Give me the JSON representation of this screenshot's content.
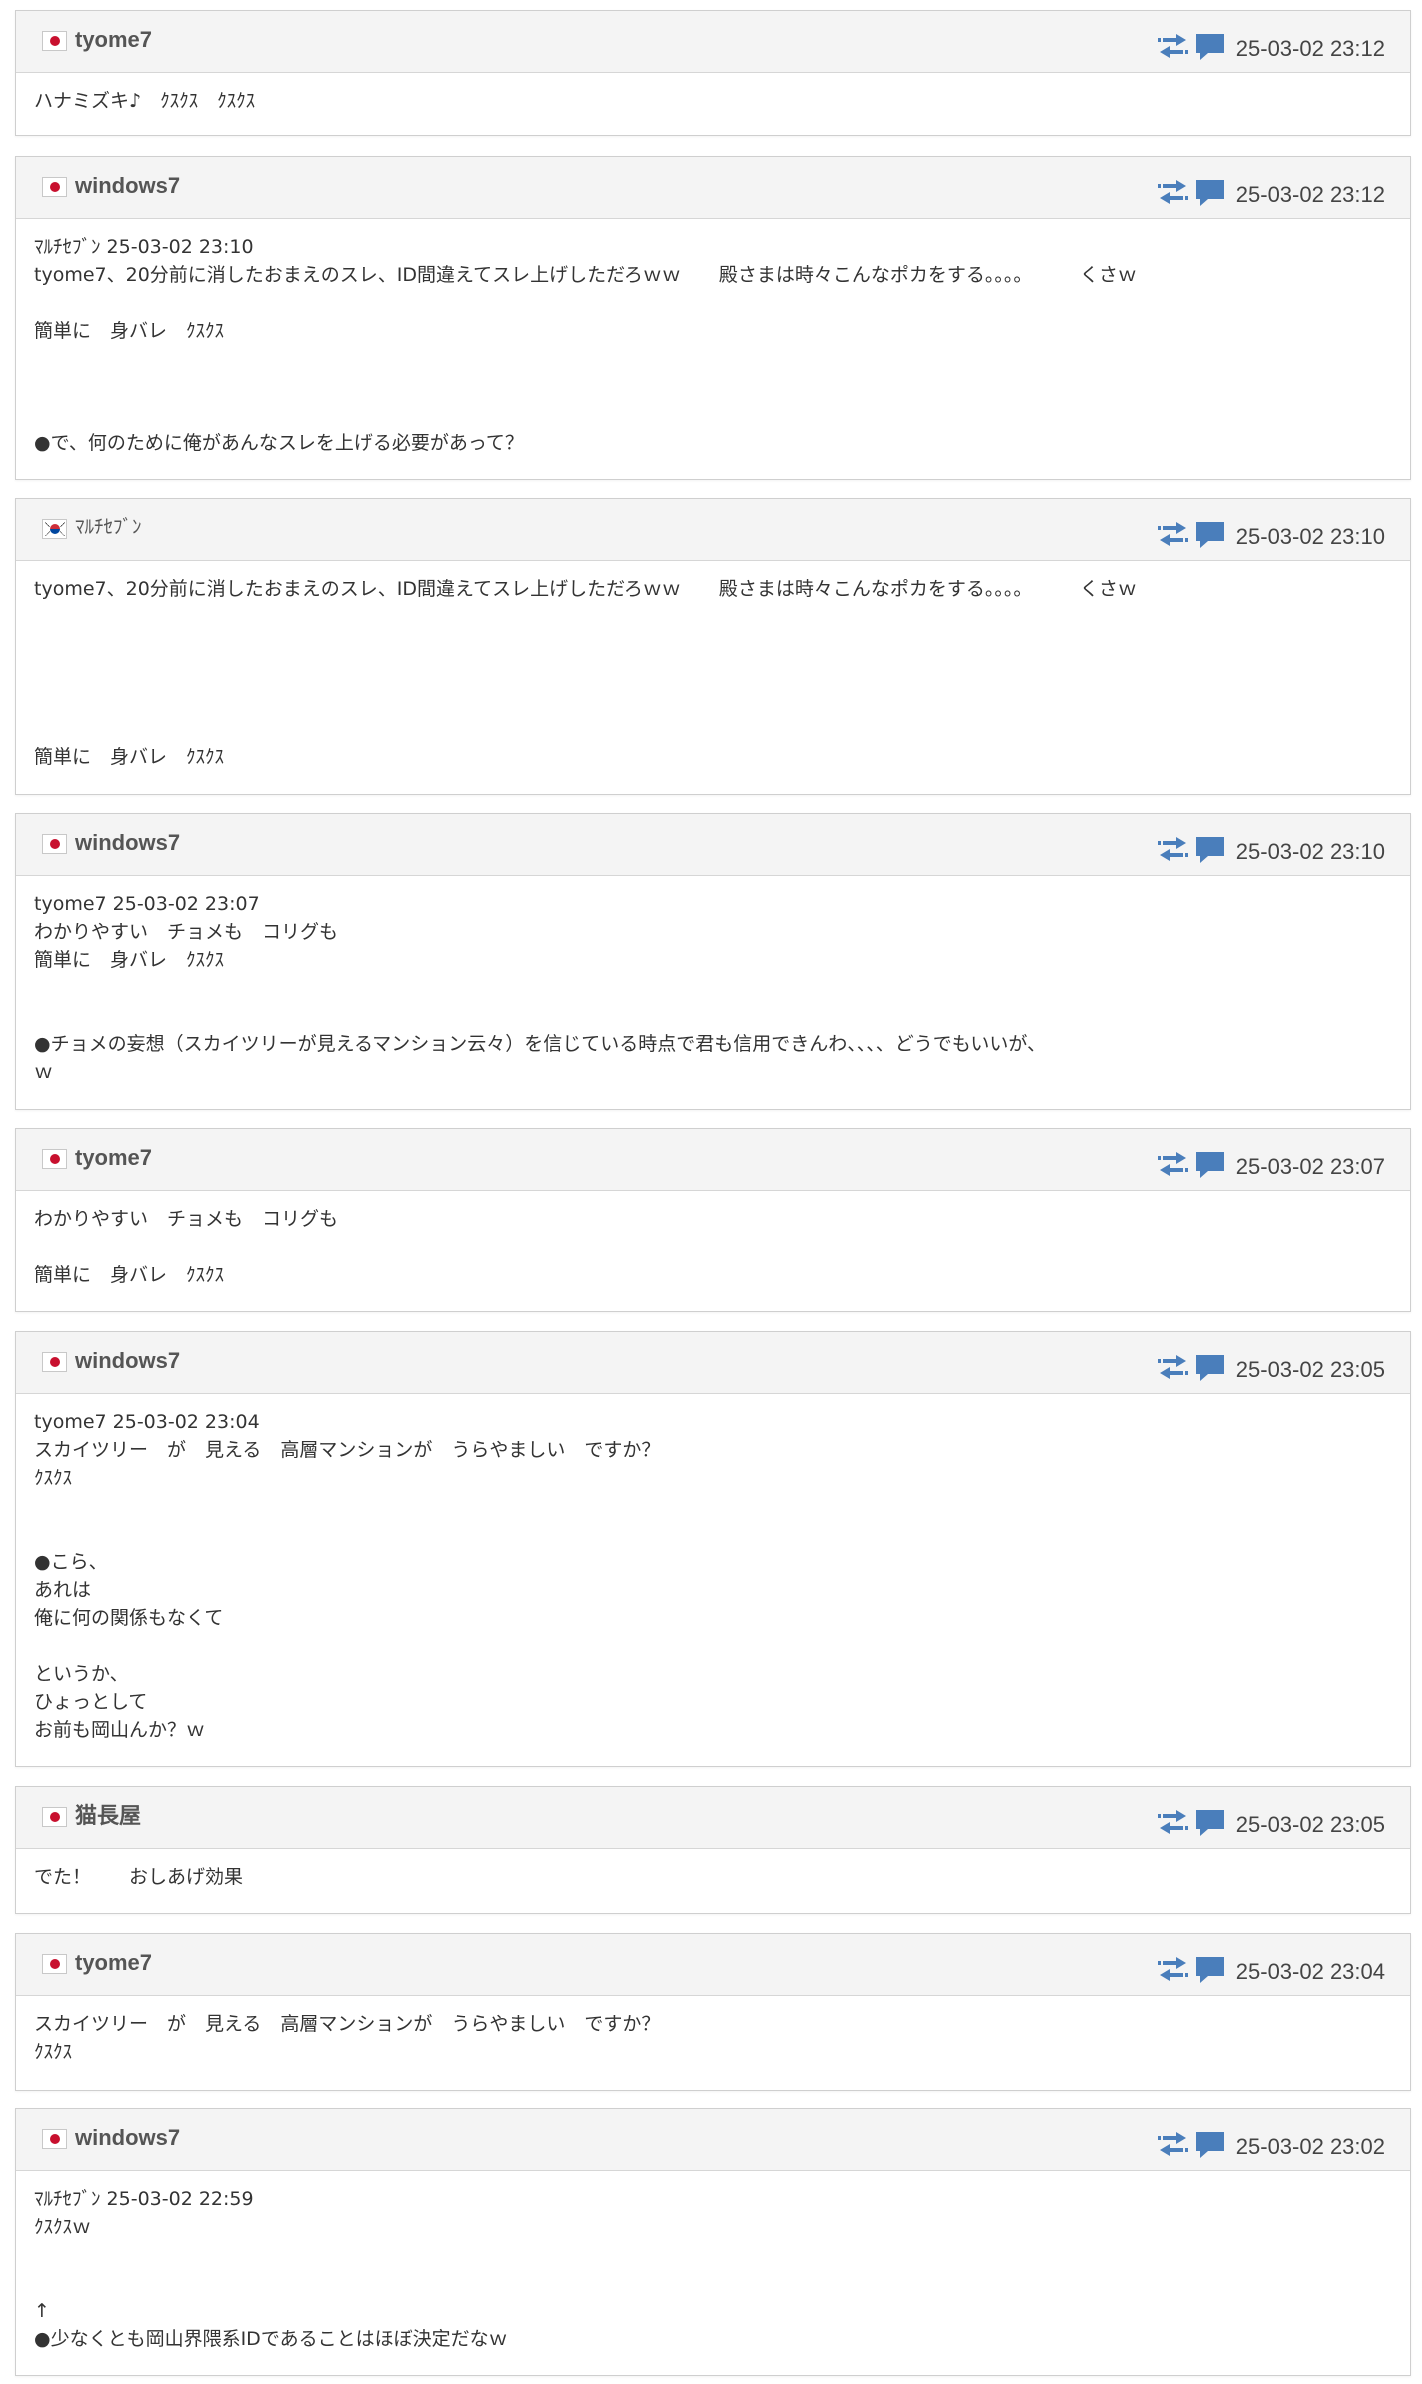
{
  "posts": [
    {
      "flag": "jp",
      "user": "tyome7",
      "time": "25-03-02 23:12",
      "lines": [
        "ハナミズキ♪　ｸｽｸｽ　ｸｽｸｽ"
      ]
    },
    {
      "flag": "jp",
      "user": "windows7",
      "time": "25-03-02 23:12",
      "lines": [
        "ﾏﾙﾁｾﾌﾞﾝ 25-03-02 23:10",
        "tyome7、20分前に消したおまえのスレ、ID間違えてスレ上げしただろｗｗ　　殿さまは時々こんなポカをする。。。。　　　くさｗ",
        "",
        "簡単に　身バレ　ｸｽｸｽ",
        "",
        "",
        "",
        "●で、何のために俺があんなスレを上げる必要があって？"
      ]
    },
    {
      "flag": "kr",
      "user": "ﾏﾙﾁｾﾌﾞﾝ",
      "time": "25-03-02 23:10",
      "lines": [
        "tyome7、20分前に消したおまえのスレ、ID間違えてスレ上げしただろｗｗ　　殿さまは時々こんなポカをする。。。。　　　くさｗ",
        "",
        "",
        "",
        "",
        "",
        "簡単に　身バレ　ｸｽｸｽ"
      ]
    },
    {
      "flag": "jp",
      "user": "windows7",
      "time": "25-03-02 23:10",
      "lines": [
        "tyome7 25-03-02 23:07",
        "わかりやすい　チョメも　コリグも",
        "簡単に　身バレ　ｸｽｸｽ",
        "",
        "",
        "●チョメの妄想（スカイツリーが見えるマンション云々）を信じている時点で君も信用できんわ、、、、どうでもいいが、",
        "ｗ"
      ]
    },
    {
      "flag": "jp",
      "user": "tyome7",
      "time": "25-03-02 23:07",
      "lines": [
        "わかりやすい　チョメも　コリグも",
        "",
        "簡単に　身バレ　ｸｽｸｽ"
      ]
    },
    {
      "flag": "jp",
      "user": "windows7",
      "time": "25-03-02 23:05",
      "lines": [
        "tyome7 25-03-02 23:04",
        "スカイツリー　が　見える　高層マンションが　うらやましい　ですか？",
        "ｸｽｸｽ",
        "",
        "",
        "●こら、",
        "あれは",
        "俺に何の関係もなくて",
        "",
        "というか、",
        "ひょっとして",
        "お前も岡山んか？ｗ"
      ]
    },
    {
      "flag": "jp",
      "user": "猫長屋",
      "time": "25-03-02 23:05",
      "lines": [
        "でた！　　おしあげ効果"
      ]
    },
    {
      "flag": "jp",
      "user": "tyome7",
      "time": "25-03-02 23:04",
      "lines": [
        "スカイツリー　が　見える　高層マンションが　うらやましい　ですか？",
        "ｸｽｸｽ"
      ]
    },
    {
      "flag": "jp",
      "user": "windows7",
      "time": "25-03-02 23:02",
      "lines": [
        "ﾏﾙﾁｾﾌﾞﾝ 25-03-02 22:59",
        "ｸｽｸｽｗ",
        "",
        "",
        "↑",
        "●少なくとも岡山界隈系IDであることはほぼ決定だなｗ"
      ]
    }
  ],
  "icons": {
    "transfer": "transfer-arrows-icon",
    "reply": "speech-bubble-icon"
  },
  "colors": {
    "icon_blue": "#4a7ebb",
    "header_bg": "#f4f4f4",
    "flag_red": "#c8102e"
  }
}
